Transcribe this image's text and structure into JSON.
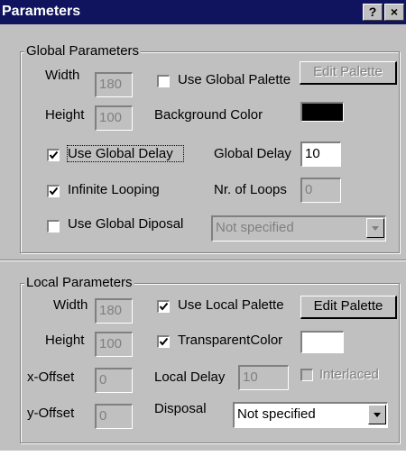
{
  "window": {
    "title": "Parameters",
    "help_label": "?",
    "close_label": "×"
  },
  "global": {
    "group_title": "Global Parameters",
    "width_label": "Width",
    "width_value": "180",
    "height_label": "Height",
    "height_value": "100",
    "use_global_palette_label": "Use Global Palette",
    "use_global_palette_checked": false,
    "edit_palette_label": "Edit Palette",
    "background_color_label": "Background Color",
    "background_color": "#000000",
    "use_global_delay_label": "Use Global Delay",
    "use_global_delay_checked": true,
    "global_delay_label": "Global Delay",
    "global_delay_value": "10",
    "infinite_looping_label": "Infinite Looping",
    "infinite_looping_checked": true,
    "nr_loops_label": "Nr. of Loops",
    "nr_loops_value": "0",
    "use_global_disposal_label": "Use Global Diposal",
    "use_global_disposal_checked": false,
    "disposal_value": "Not specified"
  },
  "local": {
    "group_title": "Local Parameters",
    "width_label": "Width",
    "width_value": "180",
    "height_label": "Height",
    "height_value": "100",
    "use_local_palette_label": "Use Local Palette",
    "use_local_palette_checked": true,
    "edit_palette_label": "Edit Palette",
    "transparent_color_label": "TransparentColor",
    "transparent_color_checked": true,
    "transparent_color": "#ffffff",
    "x_offset_label": "x-Offset",
    "x_offset_value": "0",
    "local_delay_label": "Local Delay",
    "local_delay_value": "10",
    "interlaced_label": "Interlaced",
    "interlaced_checked": false,
    "y_offset_label": "y-Offset",
    "y_offset_value": "0",
    "disposal_label": "Disposal",
    "disposal_value": "Not specified"
  }
}
